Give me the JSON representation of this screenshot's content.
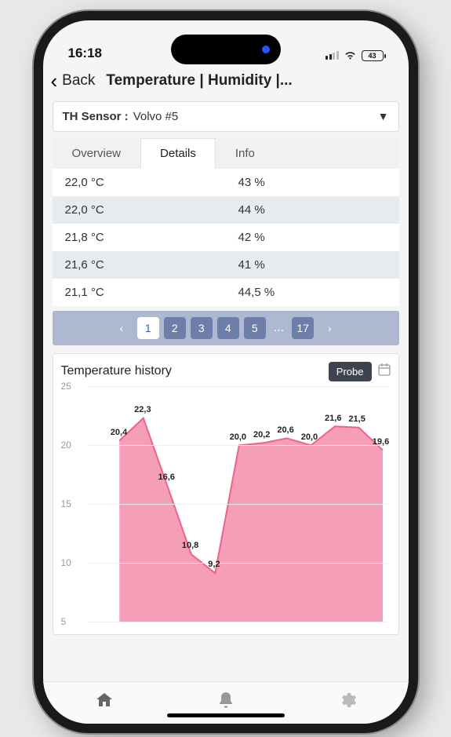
{
  "status": {
    "time": "16:18",
    "battery": "43"
  },
  "header": {
    "back": "Back",
    "title": "Temperature | Humidity |..."
  },
  "selector": {
    "label": "TH Sensor :",
    "value": "Volvo #5"
  },
  "tabs": {
    "overview": "Overview",
    "details": "Details",
    "info": "Info",
    "active": "details"
  },
  "table": {
    "rows": [
      {
        "temp": "22,0 °C",
        "hum": "43 %"
      },
      {
        "temp": "22,0 °C",
        "hum": "44 %"
      },
      {
        "temp": "21,8 °C",
        "hum": "42 %"
      },
      {
        "temp": "21,6 °C",
        "hum": "41 %"
      },
      {
        "temp": "21,1 °C",
        "hum": "44,5 %"
      }
    ]
  },
  "pager": {
    "pages": [
      "1",
      "2",
      "3",
      "4",
      "5"
    ],
    "last": "17",
    "active": "1"
  },
  "chart": {
    "title": "Temperature history",
    "probe": "Probe"
  },
  "chart_data": {
    "type": "area",
    "title": "Temperature history",
    "xlabel": "",
    "ylabel": "",
    "ylim": [
      5,
      25
    ],
    "yticks": [
      5,
      10,
      15,
      20,
      25
    ],
    "values": [
      20.4,
      22.3,
      16.6,
      10.8,
      9.2,
      20.0,
      20.2,
      20.6,
      20.0,
      21.6,
      21.5,
      19.6
    ],
    "data_labels": [
      "20,4",
      "22,3",
      "16,6",
      "10,8",
      "9,2",
      "20,0",
      "20,2",
      "20,6",
      "20,0",
      "21,6",
      "21,5",
      "19,6"
    ],
    "series_color": "#ee6389",
    "fill_color": "#f38daa"
  }
}
